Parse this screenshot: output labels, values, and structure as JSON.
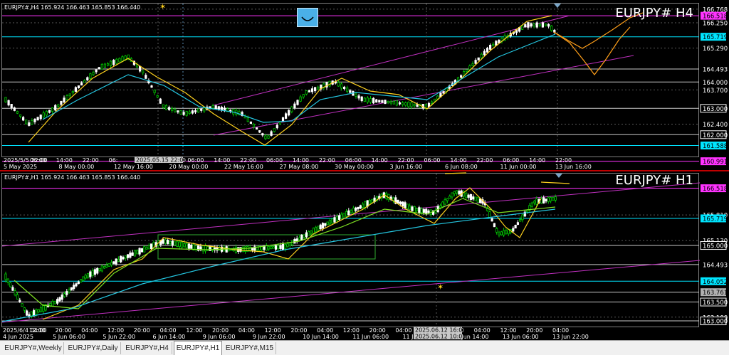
{
  "colors": {
    "bg": "#000000",
    "bull": "#00c800",
    "bear": "#ffffff",
    "ma_yellow": "#ffd21e",
    "ma_cyan": "#24c6e0",
    "ma_green": "#7ee022",
    "forecast": "#ff9f1a",
    "channel": "#c030c0",
    "level_magenta": "#ff33ff",
    "level_cyan": "#00e5ff",
    "level_white": "#ffffff"
  },
  "panels": [
    {
      "key": "h4",
      "info": "EURJPY#,H4  165.924 166.463 165.853 166.440",
      "big_label": "EURJPY#  H4",
      "price_labels": [
        {
          "text": "166.768",
          "value": 166.768,
          "style": "plain"
        },
        {
          "text": "166.518",
          "value": 166.518,
          "style": "magenta"
        },
        {
          "text": "166.250",
          "value": 166.25,
          "style": "plain"
        },
        {
          "text": "165.719",
          "value": 165.719,
          "style": "cyan"
        },
        {
          "text": "165.290",
          "value": 165.29,
          "style": "plain"
        },
        {
          "text": "164.493",
          "value": 164.493,
          "style": "plain"
        },
        {
          "text": "164.000",
          "value": 164.0,
          "style": "plain"
        },
        {
          "text": "163.700",
          "value": 163.7,
          "style": "plain"
        },
        {
          "text": "163.000",
          "value": 163.0,
          "style": "box"
        },
        {
          "text": "162.400",
          "value": 162.4,
          "style": "plain"
        },
        {
          "text": "162.000",
          "value": 162.0,
          "style": "box"
        },
        {
          "text": "161.588",
          "value": 161.588,
          "style": "cyanbox"
        },
        {
          "text": "160.991",
          "value": 160.991,
          "style": "magentabox"
        }
      ],
      "time_labels": [
        "5 May 2025",
        "8 May 00:00",
        "12 May 16:00",
        "20 May 00:00",
        "22 May 16:00",
        "27 May 08:00",
        "30 May 00:00",
        "3 Jun 16:00",
        "6 Jun 08:00",
        "11 Jun 00:00",
        "13 Jun 16:00"
      ],
      "minor_labels": [
        "2025/5/5 22:00",
        "06:00",
        "14:00",
        "22:00",
        "06:",
        "2025.05.15 22:00",
        "22:00",
        "06:00",
        "14:00",
        "22:00",
        "06:00",
        "14:00",
        "22:00",
        "06:00",
        "14:00",
        "22:00",
        "06:00",
        "14:00",
        "22:00",
        "06:00",
        "14:00",
        "22:00"
      ],
      "crosshair_labels": [
        "2025.05.15 22:00"
      ]
    },
    {
      "key": "h1",
      "info": "EURJPY#,H1  165.924 166.463 165.853 166.440",
      "big_label": "EURJPY#  H1",
      "price_labels": [
        {
          "text": "166.518",
          "value": 166.518,
          "style": "magenta"
        },
        {
          "text": "165.810",
          "value": 165.81,
          "style": "plain"
        },
        {
          "text": "165.719",
          "value": 165.719,
          "style": "cyan"
        },
        {
          "text": "165.130",
          "value": 165.13,
          "style": "plain"
        },
        {
          "text": "165.000",
          "value": 165.0,
          "style": "box"
        },
        {
          "text": "164.493",
          "value": 164.493,
          "style": "plain"
        },
        {
          "text": "164.052",
          "value": 164.052,
          "style": "cyanbox"
        },
        {
          "text": "163.761",
          "value": 163.761,
          "style": "greybox"
        },
        {
          "text": "163.500",
          "value": 163.5,
          "style": "box"
        },
        {
          "text": "163.100",
          "value": 163.1,
          "style": "plain"
        },
        {
          "text": "163.000",
          "value": 163.0,
          "style": "box"
        }
      ],
      "time_labels": [
        "4 Jun 2025",
        "5 Jun 06:00",
        "5 Jun 22:00",
        "6 Jun 14:00",
        "9 Jun 06:00",
        "9 Jun 22:00",
        "10 Jun 14:00",
        "11 Jun 06:00",
        "11 Jun 22:00",
        "12 Jun 14:00",
        "13 Jun 06:00",
        "13 Jun 22:00"
      ],
      "minor_labels": [
        "2025/6/4 04:00",
        "12:00",
        "20:00",
        "04:00",
        "12:00",
        "20:00",
        "04:00",
        "12:00",
        "20:00",
        "04:00",
        "12:00",
        "20:00",
        "04:00",
        "12:00",
        "20:00",
        "04:00",
        "12:00",
        "20:00",
        "04:00",
        "12:00",
        "20:00",
        "04:00"
      ],
      "crosshair_labels": [
        "2025.06.12 16:00",
        "2025.06.12 10:00"
      ]
    }
  ],
  "tabs": [
    {
      "label": "EURJPY#,Weekly",
      "active": false
    },
    {
      "label": "EURJPY#,Daily",
      "active": false
    },
    {
      "label": "EURJPY#,H4",
      "active": false
    },
    {
      "label": "EURJPY#,H1",
      "active": true
    },
    {
      "label": "EURJPY#,M15",
      "active": false
    }
  ]
}
